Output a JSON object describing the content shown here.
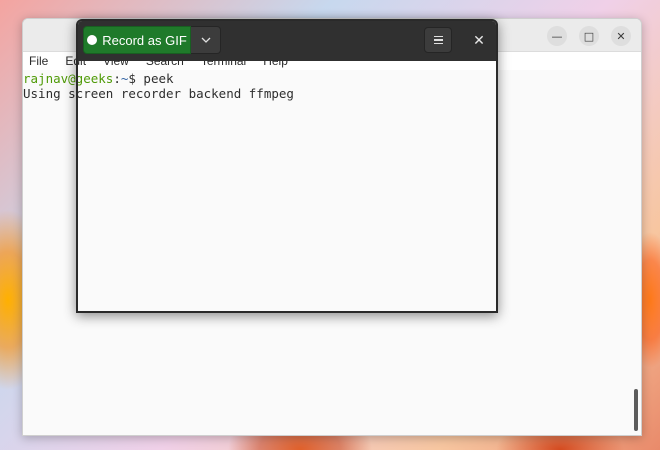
{
  "terminal": {
    "menu": [
      "File",
      "Edit",
      "View",
      "Search",
      "Terminal",
      "Help"
    ],
    "window_controls": {
      "minimize_icon": "minimize-icon",
      "maximize_icon": "maximize-icon",
      "close_icon": "close-icon",
      "minimize_glyph": "—",
      "maximize_glyph": "□",
      "close_glyph": "✕"
    },
    "lines": {
      "user_host": "rajnav@geeks",
      "path": "~",
      "symbol": "$",
      "command": " peek",
      "output": "Using screen recorder backend ffmpeg"
    }
  },
  "peek": {
    "record_label": "Record as GIF",
    "icons": {
      "dropdown": "chevron-down-icon",
      "menu": "hamburger-menu-icon",
      "close": "close-icon"
    },
    "close_glyph": "✕"
  },
  "colors": {
    "record_button": "#1f7a2a",
    "prompt_user": "#4e9a06",
    "prompt_path": "#3465a4",
    "peek_header": "#303030",
    "terminal_bg": "#fafafa"
  }
}
